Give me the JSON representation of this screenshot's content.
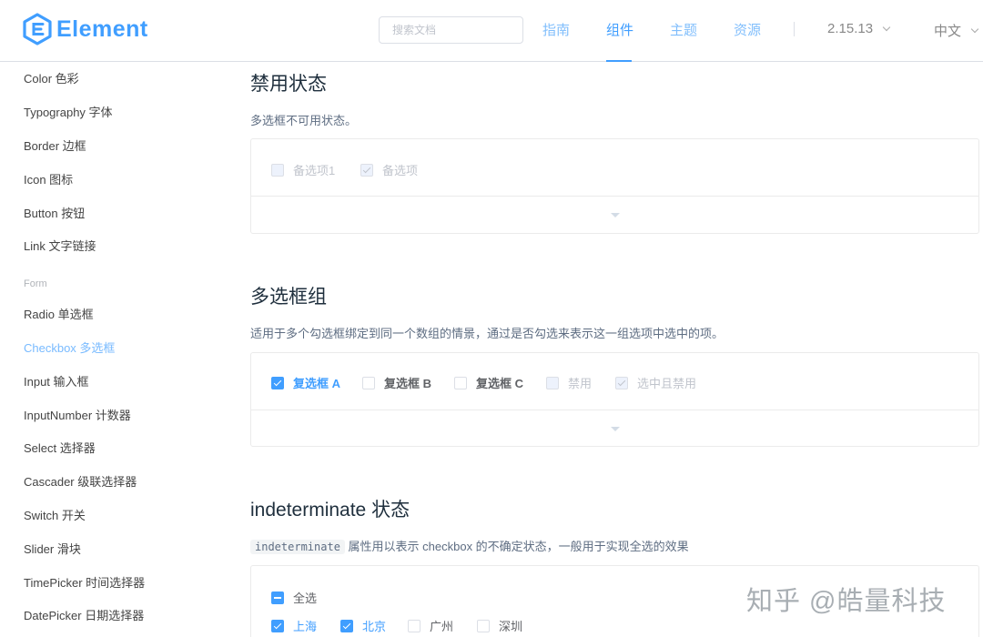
{
  "header": {
    "logo_text": "Element",
    "search_placeholder": "搜索文档",
    "nav": [
      "指南",
      "组件",
      "主题",
      "资源"
    ],
    "version": "2.15.13",
    "language": "中文"
  },
  "sidebar": {
    "items_top": [
      "Color 色彩",
      "Typography 字体",
      "Border 边框",
      "Icon 图标",
      "Button 按钮",
      "Link 文字链接"
    ],
    "group_label": "Form",
    "items_form": [
      "Radio 单选框",
      "Checkbox 多选框",
      "Input 输入框",
      "InputNumber 计数器",
      "Select 选择器",
      "Cascader 级联选择器",
      "Switch 开关",
      "Slider 滑块",
      "TimePicker 时间选择器",
      "DatePicker 日期选择器"
    ]
  },
  "sections": {
    "disabled": {
      "title": "禁用状态",
      "desc": "多选框不可用状态。",
      "options": [
        "备选项1",
        "备选项"
      ]
    },
    "group": {
      "title": "多选框组",
      "desc": "适用于多个勾选框绑定到同一个数组的情景，通过是否勾选来表示这一组选项中选中的项。",
      "options": [
        "复选框 A",
        "复选框 B",
        "复选框 C",
        "禁用",
        "选中且禁用"
      ]
    },
    "indeterminate": {
      "title": "indeterminate 状态",
      "desc_code": "indeterminate",
      "desc_rest": " 属性用以表示 checkbox 的不确定状态，一般用于实现全选的效果",
      "select_all": "全选",
      "cities": [
        "上海",
        "北京",
        "广州",
        "深圳"
      ]
    }
  },
  "watermark": "知乎 @皓量科技",
  "colors": {
    "primary": "#409eff",
    "text": "#1f2f3d",
    "secondary": "#5e6d82"
  }
}
